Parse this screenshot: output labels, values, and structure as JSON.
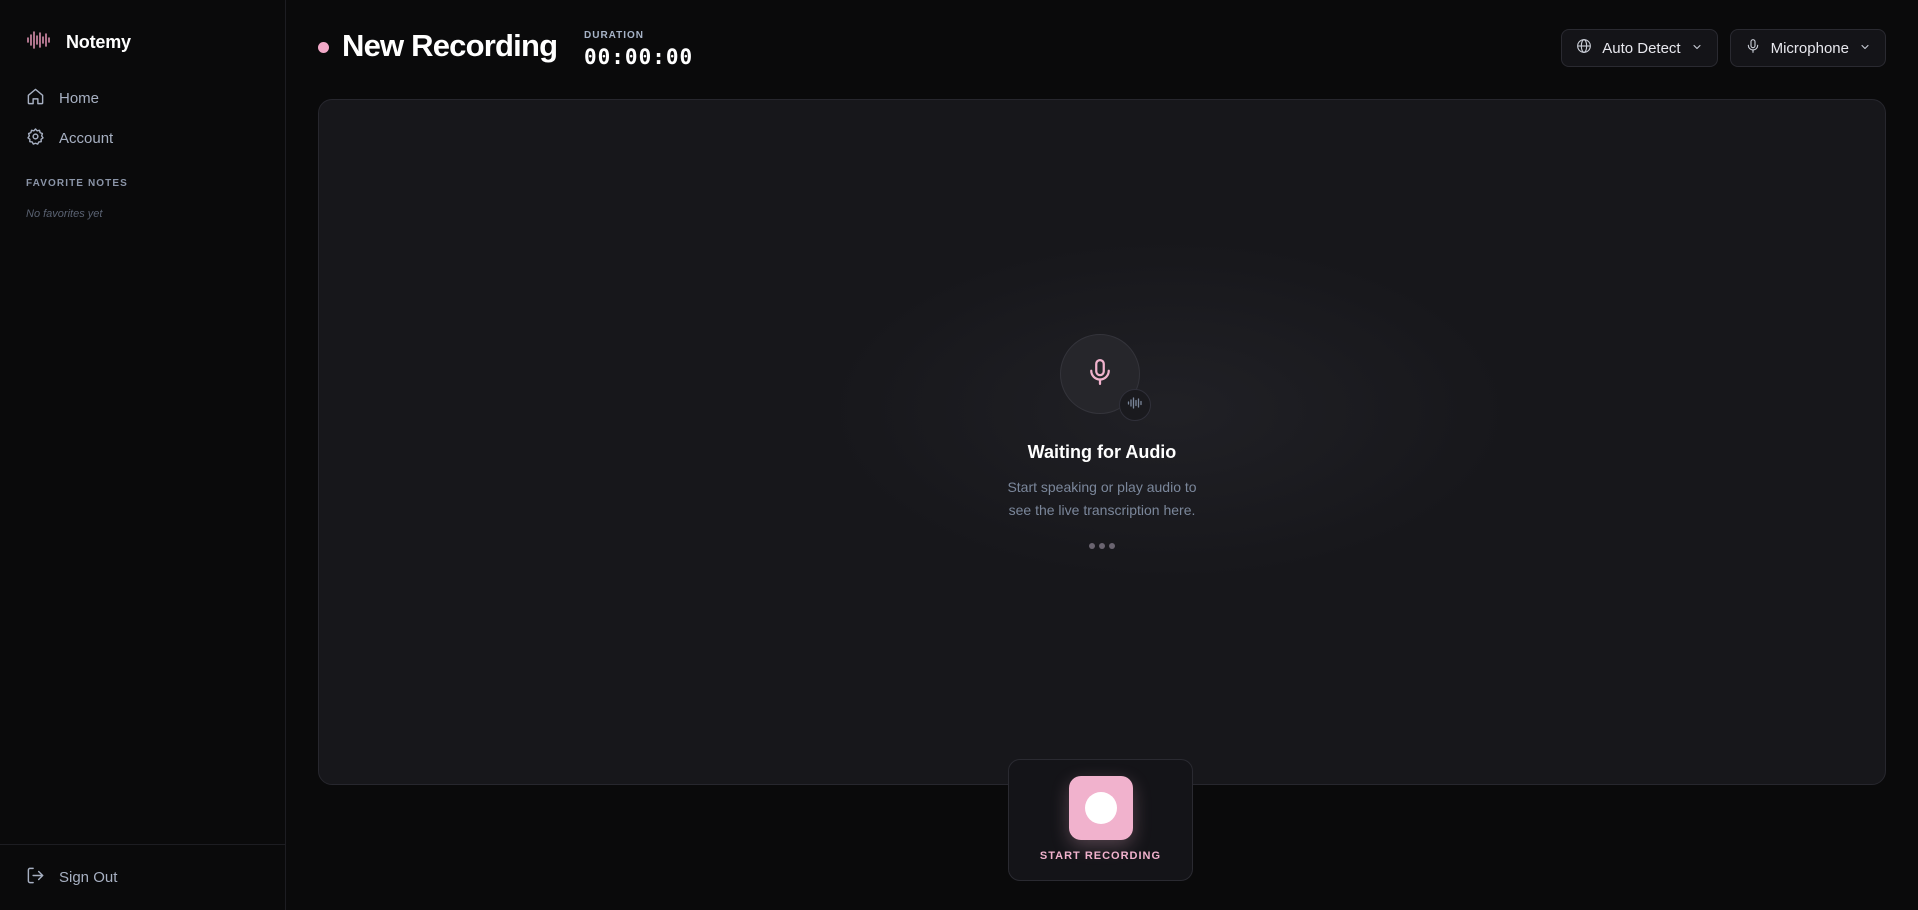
{
  "sidebar": {
    "brand": "Notemy",
    "nav": [
      {
        "label": "Home",
        "icon": "home-icon"
      },
      {
        "label": "Account",
        "icon": "gear-icon"
      }
    ],
    "favorites_title": "FAVORITE NOTES",
    "favorites_empty": "No favorites yet",
    "sign_out": "Sign Out"
  },
  "header": {
    "title": "New Recording",
    "duration_label": "DURATION",
    "duration_value": "00:00:00",
    "language_select": "Auto Detect",
    "input_select": "Microphone"
  },
  "panel": {
    "title": "Waiting for Audio",
    "line1": "Start speaking or play audio to",
    "line2": "see the live transcription here."
  },
  "record": {
    "label": "START RECORDING"
  },
  "colors": {
    "accent": "#f1b2cd",
    "background": "#0a0a0b",
    "panel": "#17171b"
  }
}
